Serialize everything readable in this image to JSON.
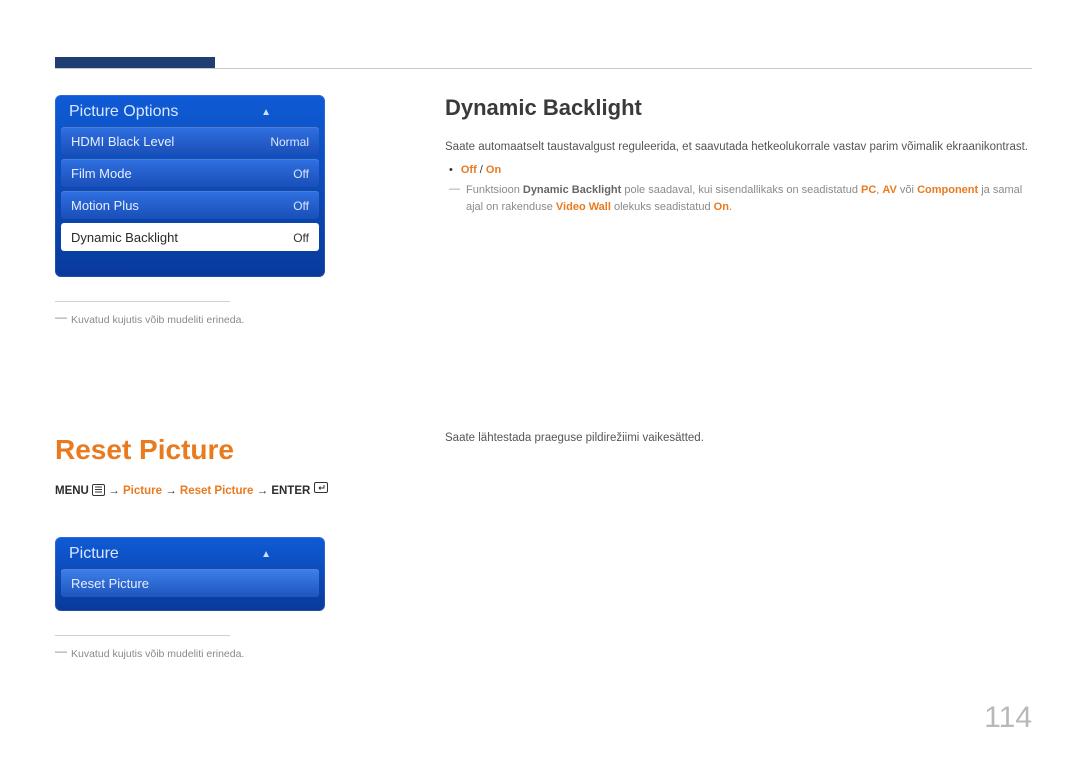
{
  "page_number": "114",
  "section1": {
    "menu_title": "Picture Options",
    "rows": [
      {
        "label": "HDMI Black Level",
        "value": "Normal"
      },
      {
        "label": "Film Mode",
        "value": "Off"
      },
      {
        "label": "Motion Plus",
        "value": "Off"
      },
      {
        "label": "Dynamic Backlight",
        "value": "Off"
      }
    ],
    "note_dash": "―",
    "note": "Kuvatud kujutis võib mudeliti erineda."
  },
  "right1": {
    "heading": "Dynamic Backlight",
    "desc": "Saate automaatselt taustavalgust reguleerida, et saavutada hetkeolukorrale vastav parim võimalik ekraanikontrast.",
    "opt_off": "Off",
    "opt_sep": " / ",
    "opt_on": "On",
    "note_a": "Funktsioon ",
    "note_b": "Dynamic Backlight",
    "note_c": " pole saadaval, kui sisendallikaks on seadistatud ",
    "note_pc": "PC",
    "note_d": ", ",
    "note_av": "AV",
    "note_e": " või ",
    "note_comp": "Component",
    "note_f": "  ja samal ajal on rakenduse ",
    "note_vw": "Video Wall",
    "note_g": " olekuks seadistatud ",
    "note_on": "On",
    "note_h": "."
  },
  "section2": {
    "heading": "Reset Picture",
    "path_menu": "MENU",
    "path_arrow": "→",
    "path_picture": "Picture",
    "path_reset": "Reset Picture",
    "path_enter": "ENTER",
    "menu_title": "Picture",
    "row_label": "Reset Picture",
    "note_dash": "―",
    "note": "Kuvatud kujutis võib mudeliti erineda."
  },
  "right2": {
    "desc": "Saate lähtestada praeguse pildirežiimi vaikesätted."
  }
}
